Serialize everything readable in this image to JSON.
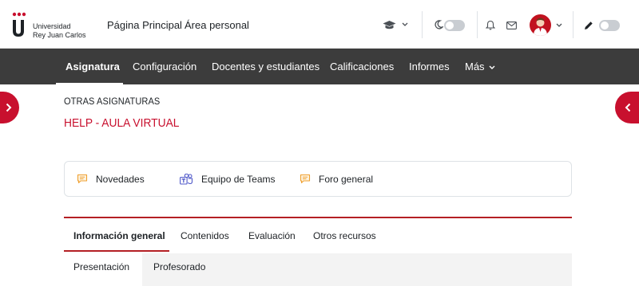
{
  "brand": {
    "line1": "Universidad",
    "line2": "Rey Juan Carlos"
  },
  "topnav": {
    "home": "Página Principal",
    "personal": "Área personal"
  },
  "colors": {
    "accent": "#c8102e",
    "navbar": "#3c3c3c"
  },
  "secondary_nav": {
    "items": [
      "Asignatura",
      "Configuración",
      "Docentes y estudiantes",
      "Calificaciones",
      "Informes",
      "Más"
    ],
    "active": "Asignatura"
  },
  "header": {
    "category": "OTRAS ASIGNATURAS",
    "title": "HELP - AULA VIRTUAL"
  },
  "activities": [
    {
      "label": "Novedades",
      "icon": "forum-icon"
    },
    {
      "label": "Equipo de Teams",
      "icon": "teams-icon"
    },
    {
      "label": "Foro general",
      "icon": "forum-icon"
    }
  ],
  "section_tabs": {
    "items": [
      "Información general",
      "Contenidos",
      "Evaluación",
      "Otros recursos"
    ],
    "active": "Información general"
  },
  "sub_tabs": {
    "items": [
      "Presentación",
      "Profesorado"
    ],
    "active": "Presentación"
  }
}
